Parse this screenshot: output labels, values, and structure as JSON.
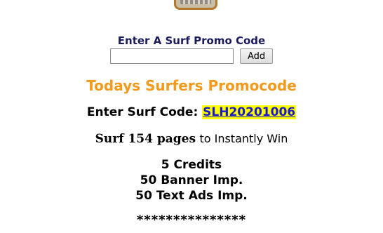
{
  "promo_form": {
    "label": "Enter A Surf Promo Code",
    "input_value": "",
    "add_label": "Add"
  },
  "todays": {
    "title": "Todays Surfers Promocode",
    "code_label": "Enter Surf Code:",
    "code_value": "SLH20201006"
  },
  "surf": {
    "prefix": "Surf 154 pages",
    "suffix": "to Instantly Win"
  },
  "rewards": [
    "5 Credits",
    "50 Banner Imp.",
    "50 Text Ads Imp."
  ],
  "separator": "***************",
  "colors": {
    "title_orange": "#f39a1b",
    "label_navy": "#1a1a5e",
    "code_highlight": "#ffff00",
    "code_link": "#1a1ac8"
  }
}
